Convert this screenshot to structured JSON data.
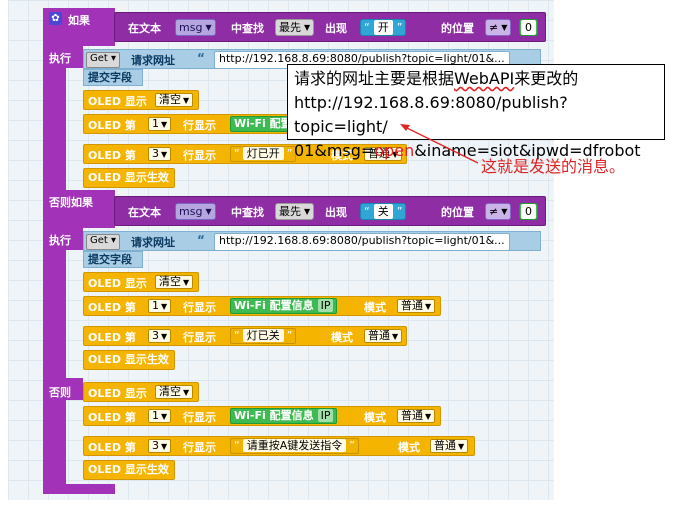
{
  "blocks": {
    "if_label": "如果",
    "exec_label": "执行",
    "elseif_label": "否则如果",
    "else_label": "否则",
    "cond1": {
      "in_text": "在文本",
      "var": "msg",
      "find": "中查找",
      "mode": "最先",
      "appear": "出现",
      "str": "开",
      "pos": "的位置",
      "op": "≠",
      "num": "0"
    },
    "cond2": {
      "in_text": "在文本",
      "var": "msg",
      "find": "中查找",
      "mode": "最先",
      "appear": "出现",
      "str": "关",
      "pos": "的位置",
      "op": "≠",
      "num": "0"
    },
    "http": {
      "method": "Get",
      "label": "请求网址",
      "url": "http://192.168.8.69:8080/publish?topic=light/01&..."
    },
    "post_field": "提交字段",
    "oled_show": "OLED 显示",
    "clear": "清空",
    "oled_line": "OLED 第",
    "row_show": "行显示",
    "mode": "模式",
    "normal": "普通",
    "oled_effect": "OLED 显示生效",
    "line1": "1",
    "line3": "3",
    "wifi_info": "Wi-Fi 配置信息",
    "wifi_info_short": "Wi-Fi 配置",
    "ip": "IP",
    "str_on": "灯已开",
    "str_off": "灯已关",
    "str_hint": "请重按A键发送指令",
    "quote_open": "“",
    "quote_close": "”"
  },
  "callout": {
    "line1_a": "请求的网址主要是根据",
    "line1_b": "WebAPI",
    "line1_c": "来更改的",
    "line2": "http://192.168.8.69:8080/publish?topic=light/",
    "line3_a": "01&msg=",
    "line3_b": "open",
    "line3_c": "&iname=siot&ipwd=dfrobot"
  },
  "note": "这就是发送的消息。",
  "colors": {
    "control": "#a233b8",
    "oled": "#f5b400",
    "http": "#a9cde4",
    "annotation": "#e02424"
  }
}
